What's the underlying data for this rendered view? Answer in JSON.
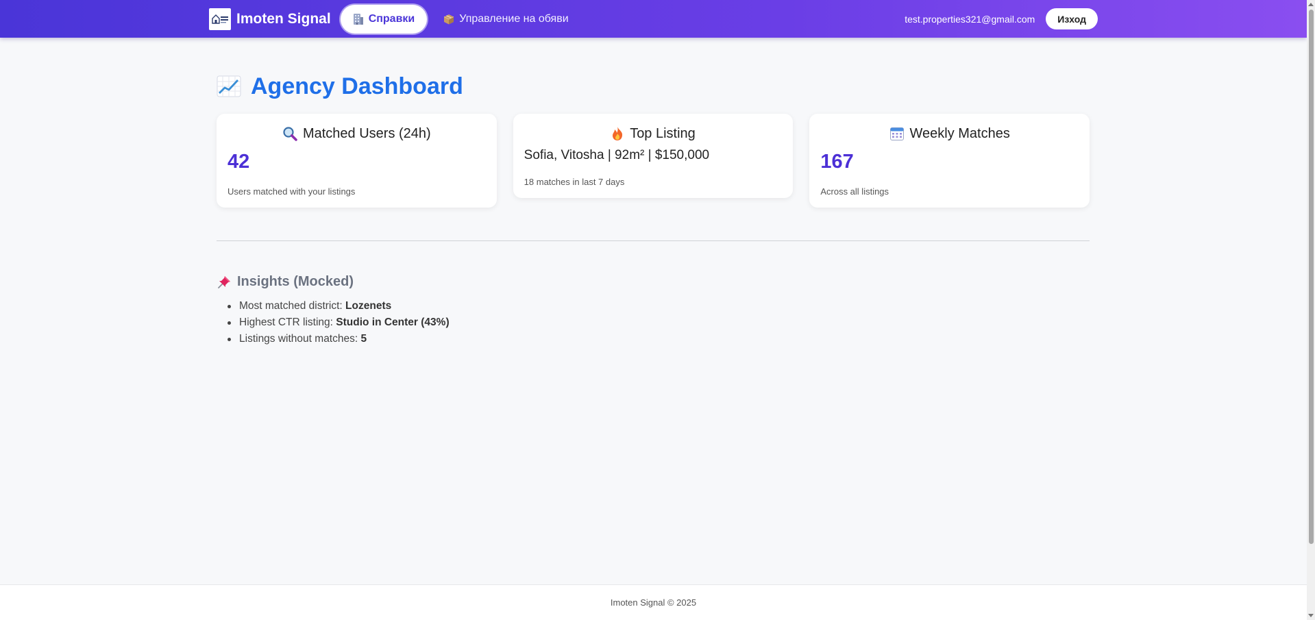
{
  "navbar": {
    "brand_name": "Imoten Signal",
    "logo_text": "IMOTEN SIGNAL",
    "nav_items": [
      {
        "label": "Справки",
        "icon": "office-building-icon",
        "active": true
      },
      {
        "label": "Управление на обяви",
        "icon": "package-box-icon",
        "active": false
      }
    ],
    "user_email": "test.properties321@gmail.com",
    "logout_label": "Изход"
  },
  "dashboard": {
    "title": "Agency Dashboard",
    "title_icon": "chart-increasing-icon",
    "cards": {
      "matched_users": {
        "icon": "magnifying-glass-icon",
        "title": "Matched Users (24h)",
        "value": "42",
        "subtitle": "Users matched with your listings"
      },
      "top_listing": {
        "icon": "fire-icon",
        "title": "Top Listing",
        "listing": "Sofia, Vitosha | 92m² | $150,000",
        "subtitle": "18 matches in last 7 days"
      },
      "weekly_matches": {
        "icon": "calendar-icon",
        "title": "Weekly Matches",
        "value": "167",
        "subtitle": "Across all listings"
      }
    }
  },
  "insights": {
    "icon": "pushpin-icon",
    "title": "Insights (Mocked)",
    "items": [
      {
        "label": "Most matched district: ",
        "value": "Lozenets"
      },
      {
        "label": "Highest CTR listing: ",
        "value": "Studio in Center (43%)"
      },
      {
        "label": "Listings without matches: ",
        "value": "5"
      }
    ]
  },
  "footer": {
    "text": "Imoten Signal © 2025"
  },
  "colors": {
    "navbar_gradient_start": "#4a35d8",
    "navbar_gradient_end": "#8a4ef0",
    "title_blue": "#1f6fe8",
    "metric_purple": "#4c30d6",
    "page_bg": "#f7f8fa"
  }
}
